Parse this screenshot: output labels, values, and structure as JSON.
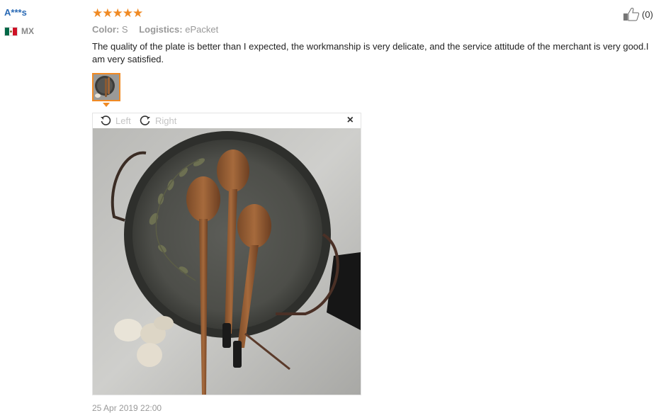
{
  "review": {
    "user_name": "A***s",
    "country_code": "MX",
    "rating": 5,
    "helpful_count": "(0)",
    "color_label": "Color:",
    "color_value": "S",
    "logistics_label": "Logistics:",
    "logistics_value": "ePacket",
    "text": "The quality of the plate is better than I expected, the workmanship is very delicate, and the service attitude of the merchant is very good.I am very satisfied.",
    "date": "25 Apr 2019 22:00"
  },
  "viewer": {
    "rotate_left_label": "Left",
    "rotate_right_label": "Right",
    "close_symbol": "×"
  },
  "colors": {
    "star": "#f08a24",
    "user_link": "#2a6ab5",
    "thumb_border": "#f08a24",
    "muted_text": "#999999"
  },
  "icons": [
    "mexico-flag-icon",
    "thumbs-up-icon",
    "rotate-left-icon",
    "rotate-right-icon",
    "close-icon",
    "star-icon"
  ]
}
